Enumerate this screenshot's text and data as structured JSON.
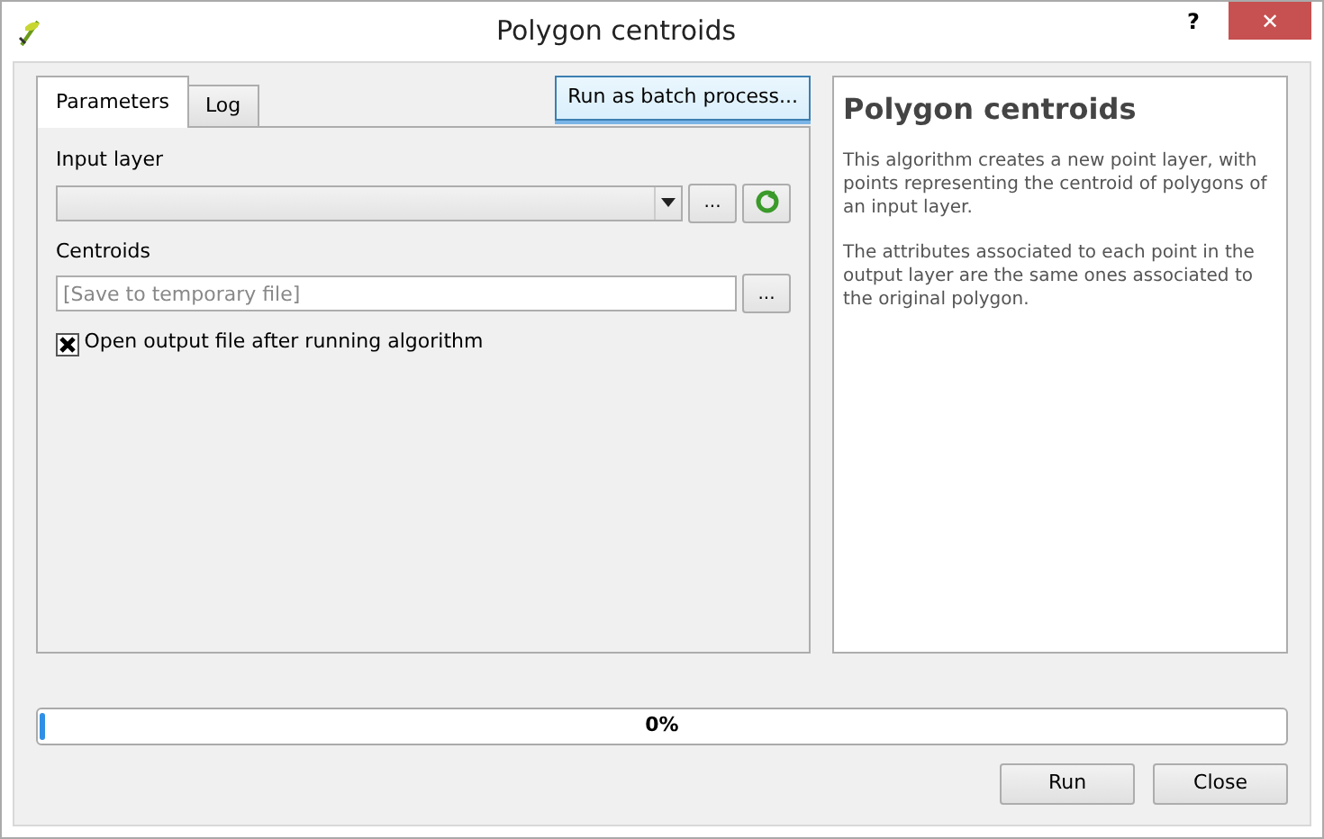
{
  "window": {
    "title": "Polygon centroids",
    "help": "?",
    "close": "✕"
  },
  "tabs": [
    {
      "label": "Parameters",
      "selected": true
    },
    {
      "label": "Log",
      "selected": false
    }
  ],
  "batch_button": "Run as batch process...",
  "parameters": [
    {
      "kind": "select",
      "label": "Input layer",
      "browse": "..."
    },
    {
      "kind": "output",
      "label": "Centroids",
      "placeholder": "[Save to temporary file]",
      "browse": "..."
    }
  ],
  "open_output": {
    "label": "Open output file after running algorithm",
    "checked": true
  },
  "help": {
    "title": "Polygon centroids",
    "paragraphs": [
      "This algorithm creates a new point layer, with points representing the centroid of polygons of an input layer.",
      "The attributes associated to each point in the output layer are the same ones associated to the original polygon."
    ]
  },
  "progress": {
    "level": 0,
    "reading": "0%"
  },
  "buttons": [
    "Run",
    "Close"
  ]
}
